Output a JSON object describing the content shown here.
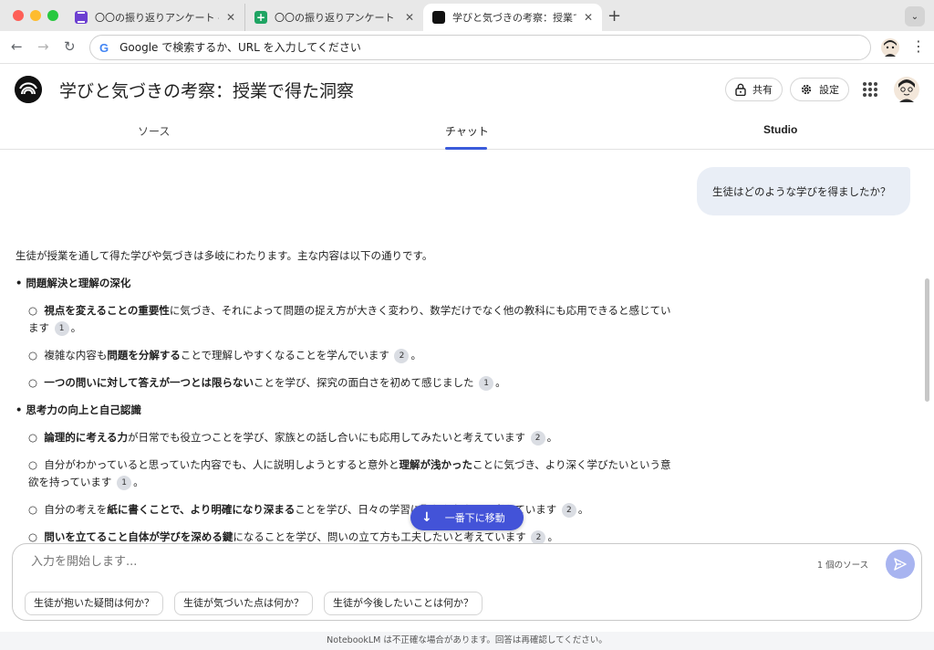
{
  "browser": {
    "tabs": [
      {
        "title": "〇〇の振り返りアンケート - Goo",
        "favicon": "google-forms-icon"
      },
      {
        "title": "〇〇の振り返りアンケート（回答",
        "favicon": "google-sheets-icon"
      },
      {
        "title": "学びと気づきの考察：授業で得た",
        "favicon": "notebooklm-icon"
      }
    ],
    "new_tab": "+",
    "omnibox_placeholder": "Google で検索するか、URL を入力してください"
  },
  "app": {
    "notebook_title": "学びと気づきの考察：授業で得た洞察",
    "share_label": "共有",
    "settings_label": "設定"
  },
  "view_tabs": {
    "sources": "ソース",
    "chat": "チャット",
    "studio": "Studio"
  },
  "chat": {
    "user_question": "生徒はどのような学びを得ましたか？",
    "answer": {
      "intro": "生徒が授業を通して得た学びや気づきは多岐にわたります。主な内容は以下の通りです。",
      "s1_heading": "• 問題解決と理解の深化",
      "s1_i1_bold": "視点を変えることの重要性",
      "s1_i1_text": "に気づき、それによって問題の捉え方が大きく変わり、数学だけでなく他の教科にも応用できると感じています",
      "s1_i1_cite": "1",
      "s1_i2_pre": "複雑な内容も",
      "s1_i2_bold": "問題を分解する",
      "s1_i2_text": "ことで理解しやすくなることを学んでいます",
      "s1_i2_cite": "2",
      "s1_i3_bold": "一つの問いに対して答えが一つとは限らない",
      "s1_i3_text": "ことを学び、探究の面白さを初めて感じました",
      "s1_i3_cite": "1",
      "s2_heading": "• 思考力の向上と自己認識",
      "s2_i1_bold": "論理的に考える力",
      "s2_i1_text": "が日常でも役立つことを学び、家族との話し合いにも応用してみたいと考えています",
      "s2_i1_cite": "2",
      "s2_i2_pre": "自分がわかっていると思っていた内容でも、人に説明しようとすると意外と",
      "s2_i2_bold": "理解が浅かった",
      "s2_i2_text": "ことに気づき、より深く学びたいという意欲を持っています",
      "s2_i2_cite": "1",
      "s2_i3_pre": "自分の考えを",
      "s2_i3_bold": "紙に書くことで、より明確になり深まる",
      "s2_i3_text": "ことを学び、日々の学習に取り入れたいと考えています",
      "s2_i3_cite": "2",
      "s2_i4_bold": "問いを立てること自体が学びを深める鍵",
      "s2_i4_text": "になることを学び、問いの立て方も工夫したいと考えています",
      "s2_i4_cite": "2",
      "bullet": "○",
      "period": "。"
    },
    "jump_to_bottom": "一番下に移動"
  },
  "composer": {
    "placeholder": "入力を開始します...",
    "source_count": "1 個のソース",
    "suggestions": [
      "生徒が抱いた疑問は何か？",
      "生徒が気づいた点は何か？",
      "生徒が今後したいことは何か？"
    ]
  },
  "footer": "NotebookLM は不正確な場合があります。回答は再確認してください。",
  "colors": {
    "accent": "#4353d8",
    "user_bubble": "#e9eef6",
    "send_disabled": "#a8b4f0"
  }
}
